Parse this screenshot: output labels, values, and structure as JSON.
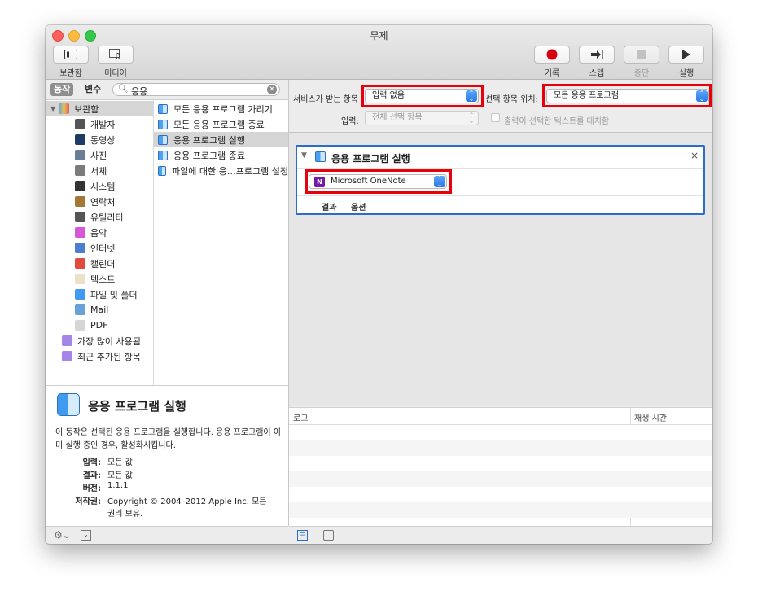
{
  "window": {
    "title": "무제"
  },
  "toolbar": {
    "library_label": "보관함",
    "media_label": "미디어",
    "record_label": "기록",
    "step_label": "스텝",
    "stop_label": "중단",
    "run_label": "실행"
  },
  "library": {
    "tab_actions": "동작",
    "tab_variables": "변수",
    "search_value": "응용",
    "root_label": "보관함",
    "categories": [
      {
        "label": "개발자",
        "icon": "tools-icon",
        "color": "#555555"
      },
      {
        "label": "동영상",
        "icon": "quicktime-icon",
        "color": "#1c3b66"
      },
      {
        "label": "사진",
        "icon": "photos-icon",
        "color": "#6a7d99"
      },
      {
        "label": "서체",
        "icon": "font-book-icon",
        "color": "#7b7b7b"
      },
      {
        "label": "시스템",
        "icon": "system-icon",
        "color": "#333333"
      },
      {
        "label": "연락처",
        "icon": "contacts-icon",
        "color": "#a2773a"
      },
      {
        "label": "유틸리티",
        "icon": "utility-icon",
        "color": "#555555"
      },
      {
        "label": "음악",
        "icon": "music-icon",
        "color": "#d657d8"
      },
      {
        "label": "인터넷",
        "icon": "internet-icon",
        "color": "#4a7ed1"
      },
      {
        "label": "캘린더",
        "icon": "calendar-icon",
        "color": "#e24b3b"
      },
      {
        "label": "텍스트",
        "icon": "text-icon",
        "color": "#e9e2c8"
      },
      {
        "label": "파일 및 폴더",
        "icon": "finder-icon",
        "color": "#3f9bef"
      },
      {
        "label": "Mail",
        "icon": "mail-icon",
        "color": "#6aa0d8"
      },
      {
        "label": "PDF",
        "icon": "pdf-icon",
        "color": "#d6d6d6"
      }
    ],
    "smart_groups": [
      {
        "label": "가장 많이 사용됨"
      },
      {
        "label": "최근 추가된 항목"
      }
    ],
    "actions": [
      {
        "label": "모든 응용 프로그램 가리기"
      },
      {
        "label": "모든 응용 프로그램 종료"
      },
      {
        "label": "응용 프로그램 실행"
      },
      {
        "label": "응용 프로그램 종료"
      },
      {
        "label": "파일에 대한 응…프로그램 설정"
      }
    ]
  },
  "description": {
    "title": "응용 프로그램 실행",
    "text": "이 동작은 선택된 응용 프로그램을 실행합니다. 응용 프로그램이 이미 실행 중인 경우, 활성화시킵니다.",
    "input_key": "입력:",
    "input_val": "모든 값",
    "result_key": "결과:",
    "result_val": "모든 값",
    "version_key": "버전:",
    "version_val": "1.1.1",
    "copyright_key": "저작권:",
    "copyright_val_1": "Copyright © 2004–2012 Apple Inc.  모든",
    "copyright_val_2": "권리 보유."
  },
  "workflow": {
    "service_receives_label": "서비스가 받는 항목",
    "service_receives_value": "입력 없음",
    "location_label": "선택 항목 위치:",
    "location_value": "모든 응용 프로그램",
    "input_label": "입력:",
    "input_value": "전체 선택 항목",
    "replace_label": "출력이 선택한 텍스트를 대치함",
    "action_title": "응용 프로그램 실행",
    "app_value": "Microsoft OneNote",
    "tab_results": "결과",
    "tab_options": "옵션"
  },
  "log": {
    "col_log": "로그",
    "col_duration": "재생 시간"
  },
  "colors": {
    "highlight_red": "#e8000a",
    "accent_blue": "#2a6ec9",
    "record_red": "#d7000f"
  }
}
